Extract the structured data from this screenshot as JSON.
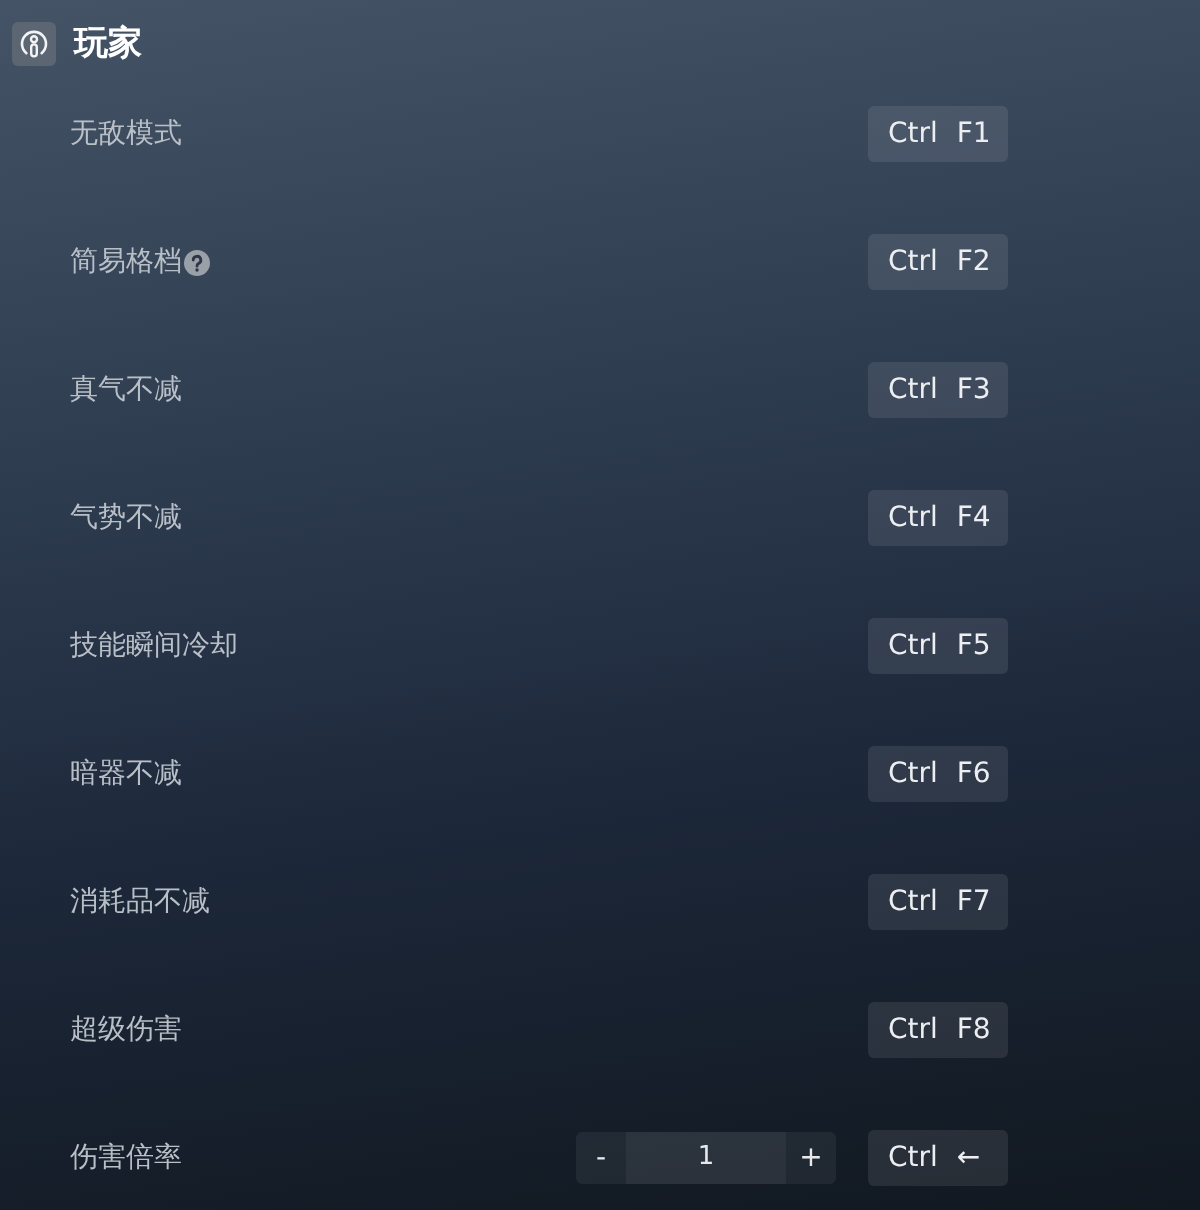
{
  "section": {
    "title": "玩家"
  },
  "rows": [
    {
      "kind": "toggle",
      "label": "无敌模式",
      "help": false,
      "hotkey": {
        "modifier": "Ctrl",
        "key": "F1"
      }
    },
    {
      "kind": "toggle",
      "label": "简易格档",
      "help": true,
      "hotkey": {
        "modifier": "Ctrl",
        "key": "F2"
      }
    },
    {
      "kind": "toggle",
      "label": "真气不减",
      "help": false,
      "hotkey": {
        "modifier": "Ctrl",
        "key": "F3"
      }
    },
    {
      "kind": "toggle",
      "label": "气势不减",
      "help": false,
      "hotkey": {
        "modifier": "Ctrl",
        "key": "F4"
      }
    },
    {
      "kind": "toggle",
      "label": "技能瞬间冷却",
      "help": false,
      "hotkey": {
        "modifier": "Ctrl",
        "key": "F5"
      }
    },
    {
      "kind": "toggle",
      "label": "暗器不减",
      "help": false,
      "hotkey": {
        "modifier": "Ctrl",
        "key": "F6"
      }
    },
    {
      "kind": "toggle",
      "label": "消耗品不减",
      "help": false,
      "hotkey": {
        "modifier": "Ctrl",
        "key": "F7"
      }
    },
    {
      "kind": "toggle",
      "label": "超级伤害",
      "help": false,
      "hotkey": {
        "modifier": "Ctrl",
        "key": "F8"
      }
    },
    {
      "kind": "stepper",
      "label": "伤害倍率",
      "help": false,
      "stepper": {
        "decrement": "-",
        "value": "1",
        "increment": "+"
      },
      "hotkey": {
        "modifier": "Ctrl",
        "key": "←"
      }
    }
  ]
}
